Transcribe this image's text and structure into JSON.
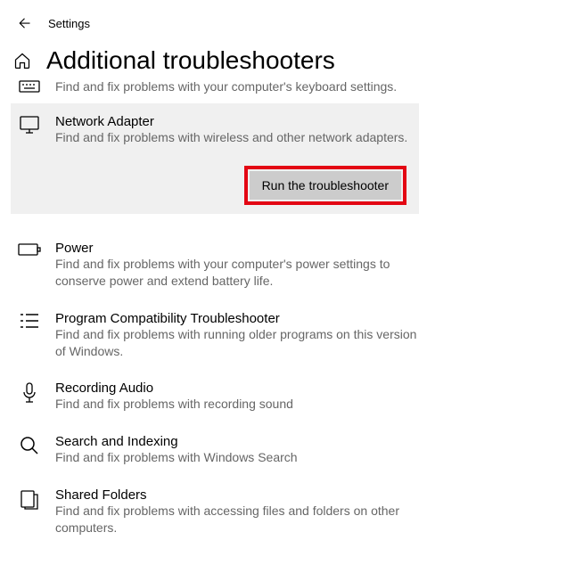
{
  "app_title": "Settings",
  "page_title": "Additional troubleshooters",
  "partial_item_desc": "Find and fix problems with your computer's keyboard settings.",
  "items": [
    {
      "name": "Network Adapter",
      "desc": "Find and fix problems with wireless and other network adapters.",
      "selected": true
    },
    {
      "name": "Power",
      "desc": "Find and fix problems with your computer's power settings to conserve power and extend battery life."
    },
    {
      "name": "Program Compatibility Troubleshooter",
      "desc": "Find and fix problems with running older programs on this version of Windows."
    },
    {
      "name": "Recording Audio",
      "desc": "Find and fix problems with recording sound"
    },
    {
      "name": "Search and Indexing",
      "desc": "Find and fix problems with Windows Search"
    },
    {
      "name": "Shared Folders",
      "desc": "Find and fix problems with accessing files and folders on other computers."
    }
  ],
  "run_button_label": "Run the troubleshooter"
}
